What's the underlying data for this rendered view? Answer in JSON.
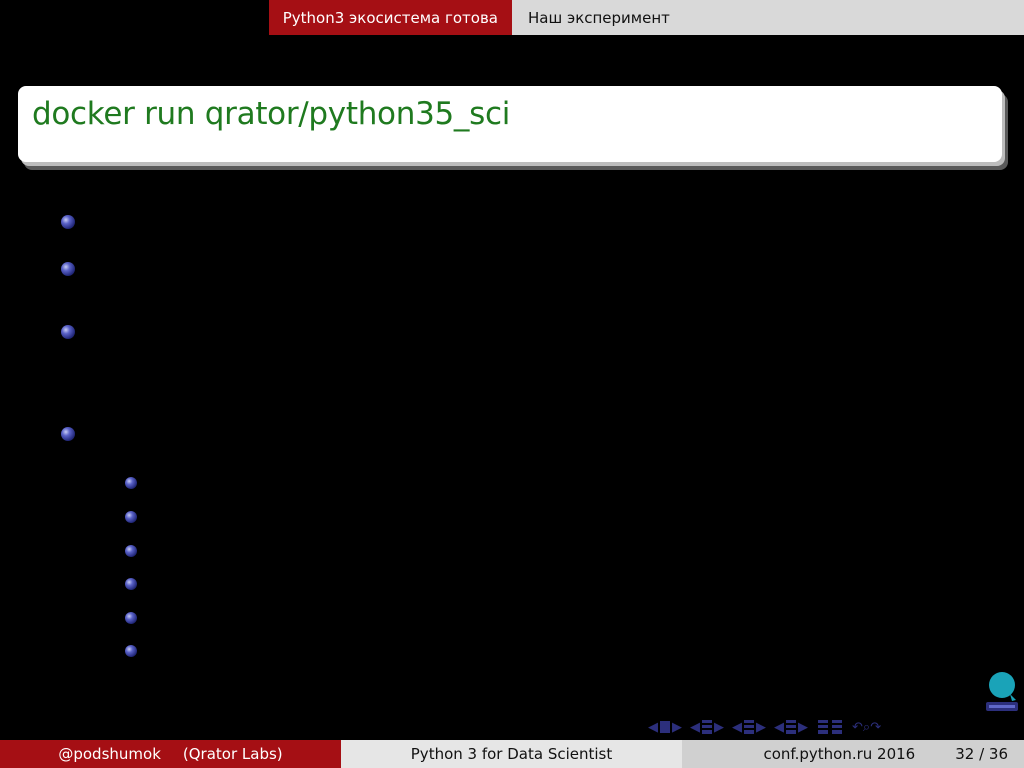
{
  "nav": {
    "section_active": "Python3 экосистема готова",
    "section_next": "Наш эксперимент"
  },
  "frame": {
    "title": "docker run qrator/python35_sci"
  },
  "bullets": {
    "level1_count": 4,
    "level2_count": 6
  },
  "footer": {
    "author": "@podshumok",
    "institute": "(Qrator Labs)",
    "talk_title": "Python 3 for Data Scientist",
    "event": "conf.python.ru 2016",
    "page": "32 / 36"
  },
  "colors": {
    "accent_red": "#a50f14",
    "title_green": "#1f7a1f",
    "bullet_blue": "#2c2f7c",
    "logo_teal": "#1aa3b8"
  },
  "icons": {
    "logo": "qrator-logo-icon",
    "nav": [
      "nav-frame-prev-icon",
      "nav-frame-next-icon",
      "nav-subsection-prev-icon",
      "nav-subsection-next-icon",
      "nav-section-prev-icon",
      "nav-section-next-icon",
      "nav-slide-prev-icon",
      "nav-slide-next-icon",
      "nav-outline-icon",
      "nav-search-icon"
    ]
  }
}
